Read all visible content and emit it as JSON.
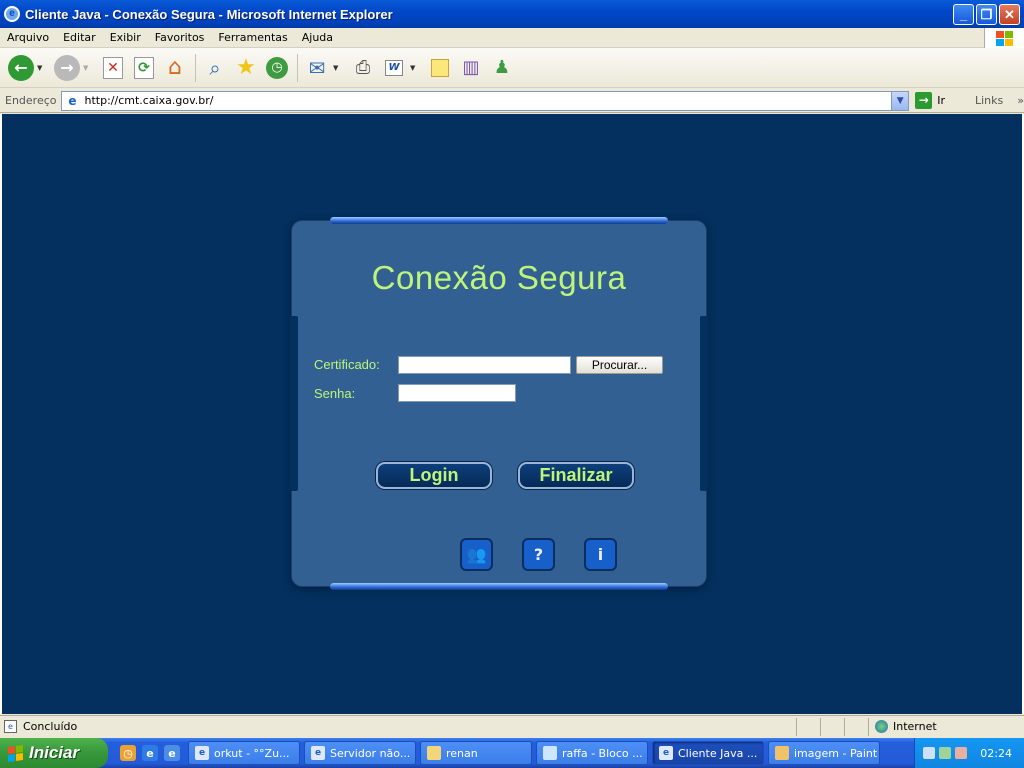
{
  "window": {
    "title": "Cliente Java - Conexão Segura - Microsoft Internet Explorer"
  },
  "menu": [
    "Arquivo",
    "Editar",
    "Exibir",
    "Favoritos",
    "Ferramentas",
    "Ajuda"
  ],
  "toolbar": {
    "buttons": [
      "back-icon",
      "forward-icon",
      "stop-icon",
      "refresh-icon",
      "home-icon",
      "search-icon",
      "favorites-icon",
      "history-icon",
      "mail-icon",
      "print-icon",
      "edit-icon",
      "discuss-icon",
      "research-icon",
      "messenger-icon"
    ]
  },
  "address": {
    "label": "Endereço",
    "url": "http://cmt.caixa.gov.br/",
    "go_label": "Ir",
    "links_label": "Links"
  },
  "login": {
    "title": "Conexão Segura",
    "cert_label": "Certificado:",
    "cert_value": "",
    "browse_label": "Procurar...",
    "password_label": "Senha:",
    "password_value": "",
    "login_button": "Login",
    "finish_button": "Finalizar",
    "icons": [
      "users-icon",
      "help-user-icon",
      "info-icon"
    ]
  },
  "status": {
    "text": "Concluído",
    "zone": "Internet"
  },
  "taskbar": {
    "start_label": "Iniciar",
    "items": [
      {
        "label": "orkut - °°Zu...",
        "active": false
      },
      {
        "label": "Servidor não...",
        "active": false
      },
      {
        "label": "renan",
        "active": false
      },
      {
        "label": "raffa - Bloco ...",
        "active": false
      },
      {
        "label": "Cliente Java ...",
        "active": true
      },
      {
        "label": "imagem - Paint",
        "active": false
      }
    ],
    "clock": "02:24"
  },
  "colors": {
    "content_bg": "#03305e",
    "panel_bg": "#336093",
    "accent_text": "#bdf57a"
  }
}
